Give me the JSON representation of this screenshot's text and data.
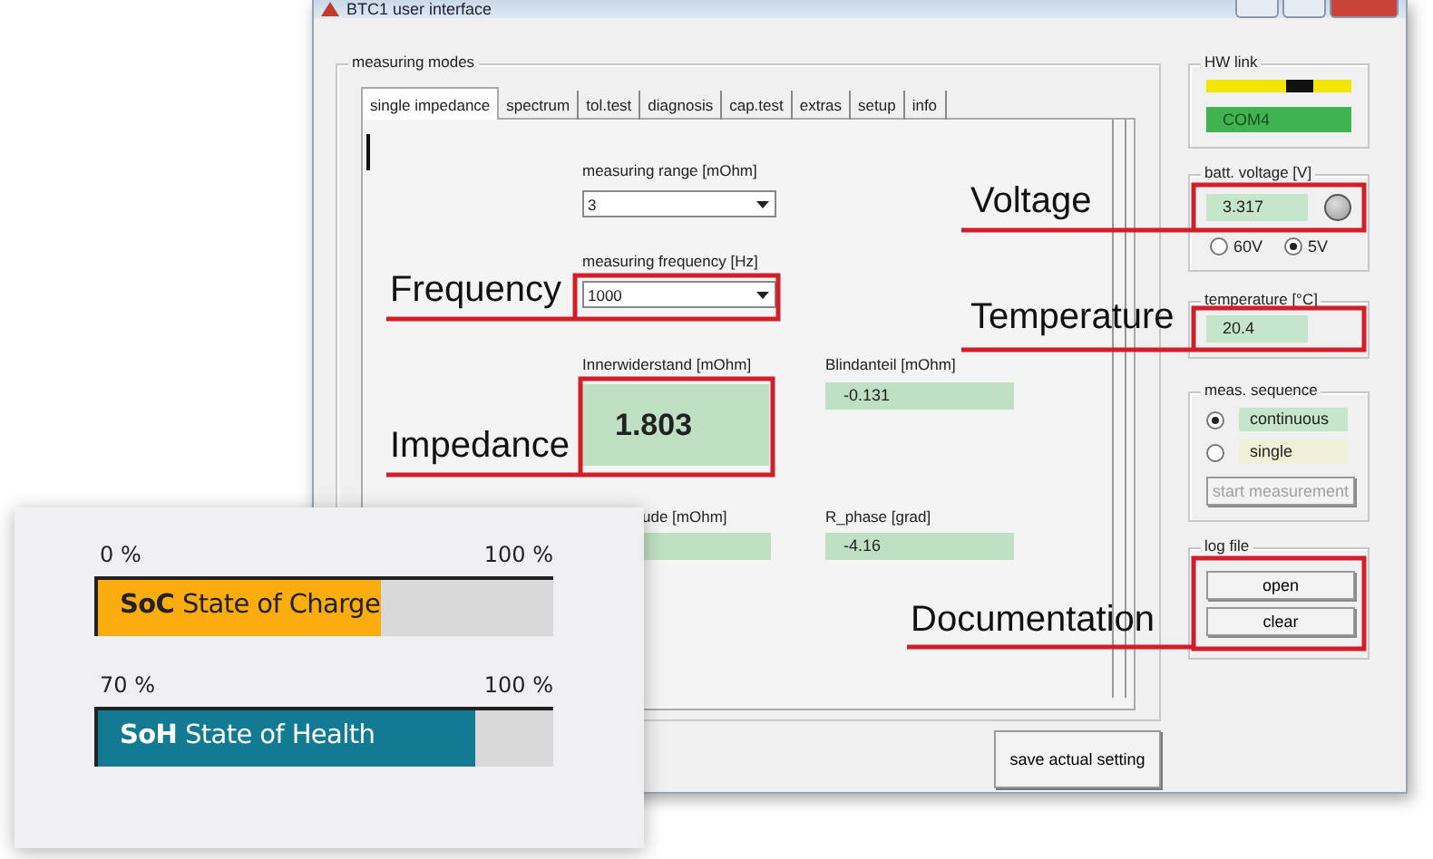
{
  "window": {
    "title": "BTC1 user interface"
  },
  "measuring_modes": {
    "title": "measuring modes",
    "tabs": [
      {
        "label": "single impedance",
        "selected": true
      },
      {
        "label": "spectrum",
        "selected": false
      },
      {
        "label": "tol.test",
        "selected": false
      },
      {
        "label": "diagnosis",
        "selected": false
      },
      {
        "label": "cap.test",
        "selected": false
      },
      {
        "label": "extras",
        "selected": false
      },
      {
        "label": "setup",
        "selected": false
      },
      {
        "label": "info",
        "selected": false
      }
    ],
    "measuring_range": {
      "label": "measuring range [mOhm]",
      "value": "3"
    },
    "measuring_frequency": {
      "label": "measuring frequency [Hz]",
      "value": "1000"
    },
    "readings": [
      {
        "label": "Innerwiderstand [mOhm]",
        "value": "1.803",
        "kind": "large"
      },
      {
        "label": "Blindanteil [mOhm]",
        "value": "-0.131",
        "kind": "small"
      },
      {
        "label": "ude [mOhm]",
        "kind": "small"
      },
      {
        "label": "R_phase [grad]",
        "value": "-4.16",
        "kind": "small"
      }
    ]
  },
  "save_button": "save actual setting",
  "hw_link": {
    "title": "HW link",
    "port": "COM4"
  },
  "batt_voltage": {
    "title": "batt. voltage [V]",
    "value": "3.317",
    "options": [
      {
        "label": "60V",
        "selected": false
      },
      {
        "label": "5V",
        "selected": true
      }
    ]
  },
  "temperature": {
    "title": "temperature [°C]",
    "value": "20.4"
  },
  "meas_sequence": {
    "title": "meas. sequence",
    "options": [
      {
        "label": "continuous",
        "selected": true
      },
      {
        "label": "single",
        "selected": false
      }
    ],
    "start_button": {
      "label": "start measurement",
      "disabled": true
    }
  },
  "log_file": {
    "title": "log file",
    "buttons": [
      "open",
      "clear"
    ]
  },
  "callouts": [
    "Voltage",
    "Frequency",
    "Temperature",
    "Impedance",
    "Documentation"
  ],
  "gauges": [
    {
      "min": "0 %",
      "max": "100 %",
      "label": "**SoC** State of Charge",
      "level": 0.62,
      "color": "#fbad10"
    },
    {
      "min": "70 %",
      "max": "100 %",
      "label": "**SoH** State of Health",
      "level": 0.83,
      "color": "#137a94"
    }
  ]
}
